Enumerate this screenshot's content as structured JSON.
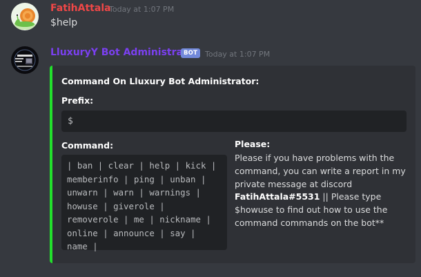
{
  "messages": [
    {
      "username": "FatihAttala",
      "username_color": "#f04747",
      "timestamp": "Today at 1:07 PM",
      "content": "$help"
    },
    {
      "username": "LluxuryY Bot Administrator",
      "username_color": "#7b40f0",
      "bot_tag": "BOT",
      "timestamp": "Today at 1:07 PM",
      "embed": {
        "accent_color": "#22e02c",
        "title": "Command On Lluxury Bot Administrator:",
        "prefix_name": "Prefix:",
        "prefix_value": "$",
        "command_name": "Command:",
        "command_lines": [
          "| ban | clear | help | kick |",
          "memberinfo | ping | unban |",
          "unwarn | warn | warnings |",
          "howuse | giverole |",
          "removerole | me | nickname |",
          "online | announce | say |",
          "name |"
        ],
        "please_name": "Please:",
        "please_lines": [
          "Please if you have problems with the",
          "command, you can write a report in my",
          "private message at discord"
        ],
        "please_bold": "FatihAttala#5531",
        "please_after_bold": " || Please type",
        "please_tail": [
          "$howuse to find out how to use the",
          "command commands on the bot**"
        ]
      }
    }
  ],
  "icons": {
    "user_avatar": "snail-avatar-icon",
    "bot_avatar": "bot-logo-avatar-icon"
  }
}
